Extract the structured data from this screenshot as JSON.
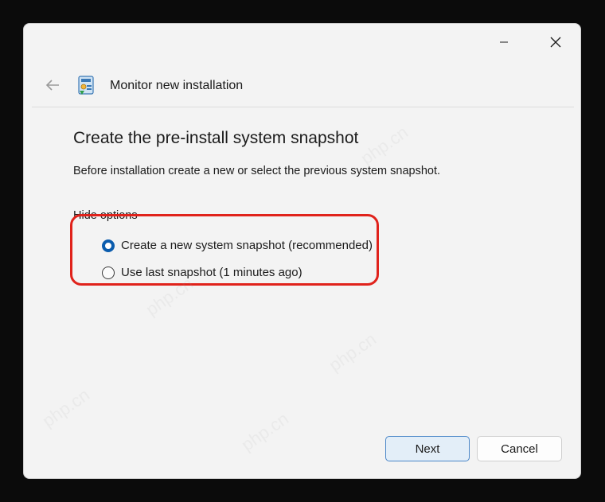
{
  "window": {
    "title": "Monitor new installation",
    "controls": {
      "minimize": "minimize",
      "close": "close"
    }
  },
  "content": {
    "heading": "Create the pre-install system snapshot",
    "description": "Before installation create a new or select the previous system snapshot.",
    "hide_options_label": "Hide options",
    "options": [
      {
        "label": "Create a new system snapshot (recommended)",
        "selected": true
      },
      {
        "label": "Use last snapshot (1 minutes ago)",
        "selected": false
      }
    ]
  },
  "buttons": {
    "next": "Next",
    "cancel": "Cancel"
  },
  "watermark": {
    "text": "php.cn"
  },
  "colors": {
    "accent": "#0b5cad",
    "annotation_red": "#e0221b",
    "next_button_bg": "#e3eef8",
    "window_bg": "#f3f3f3"
  }
}
